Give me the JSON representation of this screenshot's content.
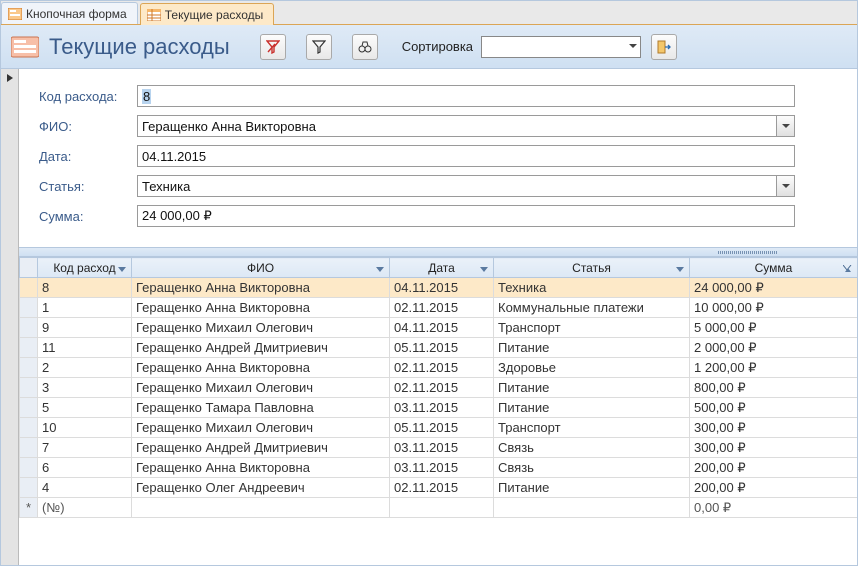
{
  "tabs": {
    "inactive_label": "Кнопочная форма",
    "active_label": "Текущие расходы"
  },
  "header": {
    "title": "Текущие расходы",
    "sort_label": "Сортировка",
    "sort_value": ""
  },
  "form": {
    "labels": {
      "id": "Код расхода:",
      "fio": "ФИО:",
      "date": "Дата:",
      "article": "Статья:",
      "sum": "Сумма:"
    },
    "values": {
      "id": "8",
      "fio": "Геращенко Анна Викторовна",
      "date": "04.11.2015",
      "article": "Техника",
      "sum": "24 000,00 ₽"
    }
  },
  "columns": {
    "id": "Код расход",
    "fio": "ФИО",
    "date": "Дата",
    "article": "Статья",
    "sum": "Сумма"
  },
  "rows": [
    {
      "id": "8",
      "fio": "Геращенко Анна Викторовна",
      "date": "04.11.2015",
      "article": "Техника",
      "sum": "24 000,00 ₽"
    },
    {
      "id": "1",
      "fio": "Геращенко Анна Викторовна",
      "date": "02.11.2015",
      "article": "Коммунальные платежи",
      "sum": "10 000,00 ₽"
    },
    {
      "id": "9",
      "fio": "Геращенко Михаил Олегович",
      "date": "04.11.2015",
      "article": "Транспорт",
      "sum": "5 000,00 ₽"
    },
    {
      "id": "11",
      "fio": "Геращенко Андрей Дмитриевич",
      "date": "05.11.2015",
      "article": "Питание",
      "sum": "2 000,00 ₽"
    },
    {
      "id": "2",
      "fio": "Геращенко Анна Викторовна",
      "date": "02.11.2015",
      "article": "Здоровье",
      "sum": "1 200,00 ₽"
    },
    {
      "id": "3",
      "fio": "Геращенко Михаил Олегович",
      "date": "02.11.2015",
      "article": "Питание",
      "sum": "800,00 ₽"
    },
    {
      "id": "5",
      "fio": "Геращенко Тамара Павловна",
      "date": "03.11.2015",
      "article": "Питание",
      "sum": "500,00 ₽"
    },
    {
      "id": "10",
      "fio": "Геращенко Михаил Олегович",
      "date": "05.11.2015",
      "article": "Транспорт",
      "sum": "300,00 ₽"
    },
    {
      "id": "7",
      "fio": "Геращенко Андрей Дмитриевич",
      "date": "03.11.2015",
      "article": "Связь",
      "sum": "300,00 ₽"
    },
    {
      "id": "6",
      "fio": "Геращенко Анна Викторовна",
      "date": "03.11.2015",
      "article": "Связь",
      "sum": "200,00 ₽"
    },
    {
      "id": "4",
      "fio": "Геращенко Олег Андреевич",
      "date": "02.11.2015",
      "article": "Питание",
      "sum": "200,00 ₽"
    }
  ],
  "new_row": {
    "marker": "*",
    "id_placeholder": "(№)",
    "sum_placeholder": "0,00 ₽"
  }
}
